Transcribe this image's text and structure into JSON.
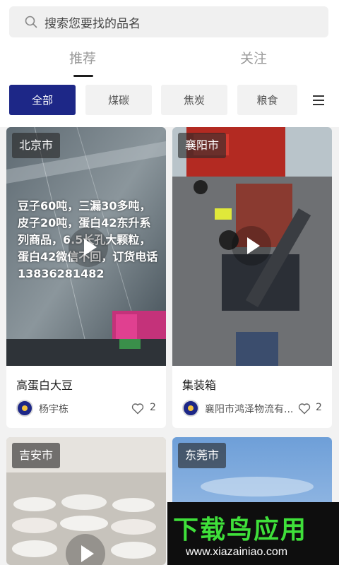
{
  "search": {
    "placeholder": "搜索您要找的品名"
  },
  "tabs": [
    {
      "label": "推荐"
    },
    {
      "label": "关注"
    }
  ],
  "categories": [
    {
      "label": "全部"
    },
    {
      "label": "煤碳"
    },
    {
      "label": "焦炭"
    },
    {
      "label": "粮食"
    }
  ],
  "cards": [
    {
      "city": "北京市",
      "overlay": "豆子60吨，三漏30多吨，皮子20吨，蛋白42东升系列商品，6.5长孔大颗粒，蛋白42微信不回，订货电话13836281482",
      "title": "高蛋白大豆",
      "author": "杨宇栋",
      "likes": "2"
    },
    {
      "city": "襄阳市",
      "title": "集装箱",
      "author": "襄阳市鸿泽物流有...",
      "likes": "2"
    },
    {
      "city": "吉安市"
    },
    {
      "city": "东莞市"
    }
  ],
  "banner": {
    "logo": "下载鸟应用",
    "url": "www.xiazainiao.com"
  },
  "colors": {
    "accent": "#1d2787",
    "banner_green": "#3fe03a"
  }
}
